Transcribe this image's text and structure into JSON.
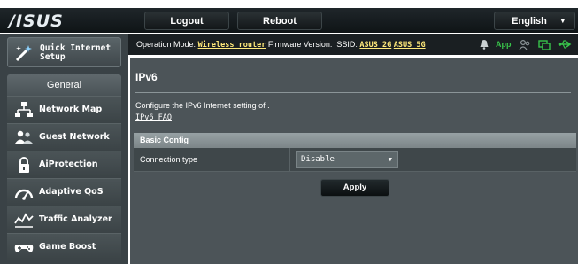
{
  "header": {
    "logo_text": "/ISUS",
    "logout_label": "Logout",
    "reboot_label": "Reboot",
    "language_label": "English"
  },
  "sidebar": {
    "quick_setup_label": "Quick Internet Setup",
    "general_label": "General",
    "items": [
      {
        "label": "Network Map",
        "icon": "network-map-icon"
      },
      {
        "label": "Guest Network",
        "icon": "guest-network-icon"
      },
      {
        "label": "AiProtection",
        "icon": "lock-icon"
      },
      {
        "label": "Adaptive QoS",
        "icon": "gauge-icon"
      },
      {
        "label": "Traffic Analyzer",
        "icon": "traffic-analyzer-icon"
      },
      {
        "label": "Game Boost",
        "icon": "gamepad-icon"
      }
    ]
  },
  "status": {
    "op_mode_label": "Operation Mode:",
    "op_mode_value": "Wireless router",
    "firmware_label": "Firmware Version:",
    "ssid_label": "SSID:",
    "ssid_values": [
      "ASUS_2G",
      "ASUS_5G"
    ],
    "app_label": "App",
    "colors": {
      "app": "#38c24a",
      "link": "#ffe97a",
      "usb": "#38c24a"
    }
  },
  "main": {
    "title": "IPv6",
    "description": "Configure the IPv6 Internet setting of .",
    "faq_link": "IPv6_FAQ",
    "section_title": "Basic Config",
    "connection_type_label": "Connection type",
    "connection_type_value": "Disable",
    "apply_label": "Apply"
  }
}
